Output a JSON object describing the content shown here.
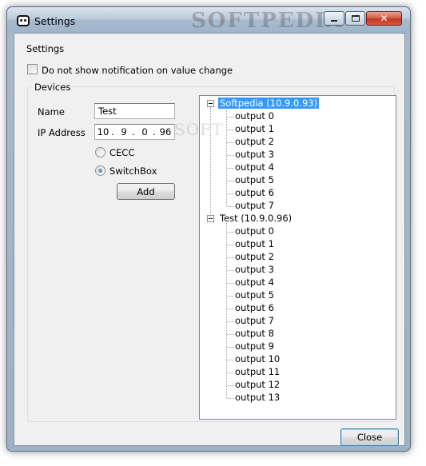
{
  "window": {
    "title": "Settings",
    "watermark": "SOFTPEDIA",
    "close_glyph": "✕"
  },
  "settings_label": "Settings",
  "notify_checkbox": {
    "label": "Do not show notification on value change",
    "checked": false
  },
  "devices": {
    "group_title": "Devices",
    "name_label": "Name",
    "name_value": "Test",
    "ip_label": "IP Address",
    "ip": [
      "10",
      "9",
      "0",
      "96"
    ],
    "radio_options": [
      {
        "label": "CECC",
        "checked": false
      },
      {
        "label": "SwitchBox",
        "checked": true
      }
    ],
    "add_label": "Add"
  },
  "tree": {
    "watermark": "SOFT",
    "devices": [
      {
        "label": "Softpedia (10.9.0.93)",
        "selected": true,
        "outputs": [
          "output 0",
          "output 1",
          "output 2",
          "output 3",
          "output 4",
          "output 5",
          "output 6",
          "output 7"
        ]
      },
      {
        "label": "Test (10.9.0.96)",
        "selected": false,
        "outputs": [
          "output 0",
          "output 1",
          "output 2",
          "output 3",
          "output 4",
          "output 5",
          "output 6",
          "output 7",
          "output 8",
          "output 9",
          "output 10",
          "output 11",
          "output 12",
          "output 13"
        ]
      }
    ]
  },
  "close_label": "Close",
  "colors": {
    "selection": "#3399ff",
    "title_close": "#c2381f"
  },
  "icons": {
    "app": "app-face-icon",
    "minimize": "minimize-icon",
    "maximize": "maximize-icon",
    "close": "close-icon"
  }
}
